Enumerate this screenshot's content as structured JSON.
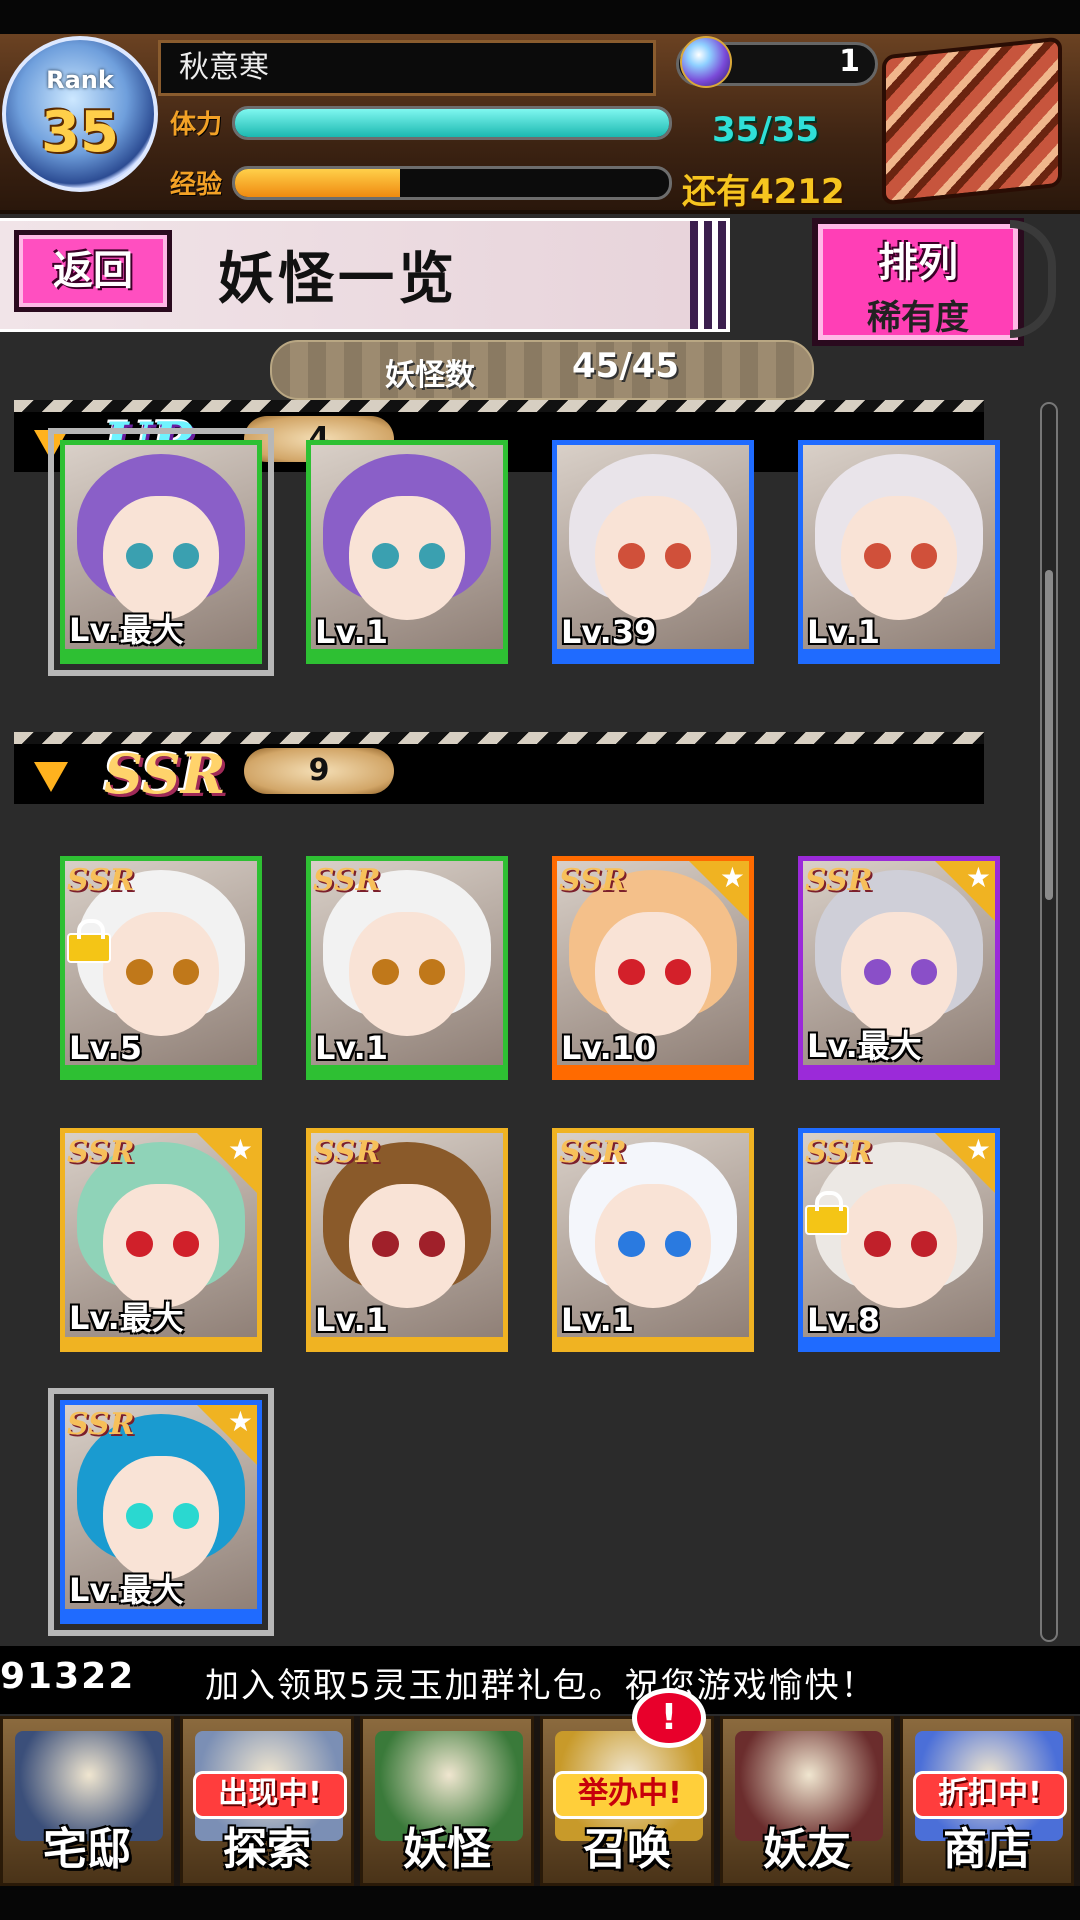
{
  "player": {
    "rank_label": "Rank",
    "rank": "35",
    "name": "秋意寒",
    "orb_count": "1"
  },
  "stats": {
    "stamina_label": "体力",
    "stamina_value": "35/35",
    "stamina_fraction": 1.0,
    "exp_label": "经验",
    "exp_value": "还有4212",
    "exp_fraction": 0.38
  },
  "title_row": {
    "back_label": "返回",
    "page_title": "妖怪一览",
    "sort_label": "排列",
    "sort_value": "稀有度"
  },
  "summary": {
    "count_label": "妖怪数",
    "count_value": "45/45"
  },
  "sections": [
    {
      "rarity": "UR",
      "count": "4",
      "cards": [
        {
          "level": "Lv.最大",
          "frame": "green",
          "hair": "#8a5fc8",
          "eye": "#3aa0b0",
          "selected": true,
          "star": false,
          "lock": false
        },
        {
          "level": "Lv.1",
          "frame": "green",
          "hair": "#8a5fc8",
          "eye": "#3aa0b0",
          "selected": false,
          "star": false,
          "lock": false
        },
        {
          "level": "Lv.39",
          "frame": "blue",
          "hair": "#e9e4ea",
          "eye": "#d0503a",
          "selected": false,
          "star": false,
          "lock": false
        },
        {
          "level": "Lv.1",
          "frame": "blue",
          "hair": "#e9e4ea",
          "eye": "#d0503a",
          "selected": false,
          "star": false,
          "lock": false
        }
      ]
    },
    {
      "rarity": "SSR",
      "count": "9",
      "cards": [
        {
          "level": "Lv.5",
          "frame": "green",
          "hair": "#f2f2f2",
          "eye": "#c0781a",
          "selected": false,
          "star": false,
          "lock": true
        },
        {
          "level": "Lv.1",
          "frame": "green",
          "hair": "#f2f2f2",
          "eye": "#c0781a",
          "selected": false,
          "star": false,
          "lock": false
        },
        {
          "level": "Lv.10",
          "frame": "orange",
          "hair": "#f4c08a",
          "eye": "#d3202a",
          "selected": false,
          "star": true,
          "lock": false
        },
        {
          "level": "Lv.最大",
          "frame": "purple",
          "hair": "#cfcfd8",
          "eye": "#8a4fc8",
          "selected": false,
          "star": true,
          "lock": false
        },
        {
          "level": "Lv.最大",
          "frame": "gold",
          "hair": "#8fd3b8",
          "eye": "#d0202a",
          "selected": false,
          "star": true,
          "lock": false
        },
        {
          "level": "Lv.1",
          "frame": "gold",
          "hair": "#8a5a2a",
          "eye": "#a0202a",
          "selected": false,
          "star": false,
          "lock": false
        },
        {
          "level": "Lv.1",
          "frame": "gold",
          "hair": "#f4f6fb",
          "eye": "#2a7ae0",
          "selected": false,
          "star": false,
          "lock": false
        },
        {
          "level": "Lv.8",
          "frame": "blue",
          "hair": "#ece8e4",
          "eye": "#c0202a",
          "selected": false,
          "star": true,
          "lock": true
        },
        {
          "level": "Lv.最大",
          "frame": "blue",
          "hair": "#1a9bd0",
          "eye": "#2ad8d0",
          "selected": true,
          "star": true,
          "lock": false
        }
      ]
    }
  ],
  "ticker": {
    "id": "91322",
    "message": "加入领取5灵玉加群礼包。祝您游戏愉快！"
  },
  "nav": [
    {
      "label": "宅邸",
      "tag": "",
      "icon": "mansion-icon",
      "color": "#3b4f7a"
    },
    {
      "label": "探索",
      "tag": "出现中!",
      "icon": "explore-icon",
      "color": "#7b8fb5"
    },
    {
      "label": "妖怪",
      "tag": "",
      "icon": "scroll-icon",
      "color": "#3a7a3a"
    },
    {
      "label": "召唤",
      "tag": "举办中!",
      "icon": "summon-icon",
      "color": "#c89a2a"
    },
    {
      "label": "妖友",
      "tag": "",
      "icon": "friend-icon",
      "color": "#6b2d2d"
    },
    {
      "label": "商店",
      "tag": "折扣中!",
      "icon": "shop-icon",
      "color": "#4b6fd8"
    }
  ],
  "notification_badge": "!"
}
